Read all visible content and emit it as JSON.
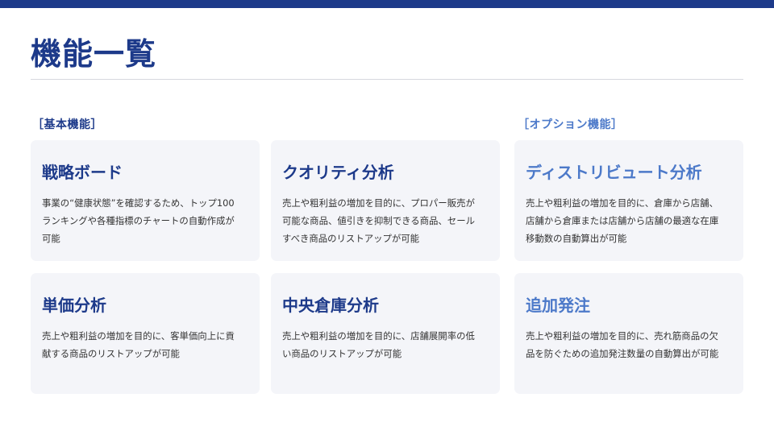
{
  "title": "機能一覧",
  "sections": {
    "basic": "［基本機能］",
    "option": "［オプション機能］"
  },
  "cards": [
    {
      "title": "戦略ボード",
      "lines": [
        "事業の“健康状態”を確認するため、トップ100",
        "ランキングや各種指標のチャートの自動作成が",
        "可能"
      ]
    },
    {
      "title": "クオリティ分析",
      "lines": [
        "売上や粗利益の増加を目的に、プロパー販売が",
        "可能な商品、値引きを抑制できる商品、セール",
        "すべき商品のリストアップが可能"
      ]
    },
    {
      "title": "ディストリビュート分析",
      "lines": [
        "売上や粗利益の増加を目的に、倉庫から店舗、",
        "店舗から倉庫または店舗から店舗の最適な在庫",
        "移動数の自動算出が可能"
      ]
    },
    {
      "title": "単価分析",
      "lines": [
        "売上や粗利益の増加を目的に、客単価向上に貢",
        "献する商品のリストアップが可能"
      ]
    },
    {
      "title": "中央倉庫分析",
      "lines": [
        "売上や粗利益の増加を目的に、店舗展開率の低",
        "い商品のリストアップが可能"
      ]
    },
    {
      "title": "追加発注",
      "lines": [
        "売上や粗利益の増加を目的に、売れ筋商品の欠",
        "品を防ぐための追加発注数量の自動算出が可能"
      ]
    }
  ],
  "colors": {
    "primary": "#1d3a8a",
    "option": "#4c79c9",
    "card_bg": "#f4f5f9",
    "text": "#333333"
  }
}
